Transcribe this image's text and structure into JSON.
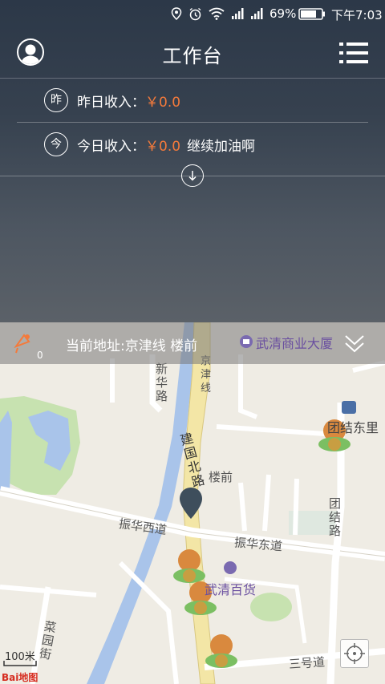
{
  "status_bar": {
    "battery": "69%",
    "time": "下午7:03"
  },
  "header": {
    "title": "工作台"
  },
  "income": {
    "yesterday": {
      "icon_char": "昨",
      "label": "昨日收入：",
      "amount": "￥0.0"
    },
    "today": {
      "icon_char": "今",
      "label": "今日收入：",
      "amount": "￥0.0",
      "slogan": "继续加油啊"
    }
  },
  "address_bar": {
    "label": "当前地址:京津线  楼前",
    "count": "0"
  },
  "map": {
    "labels": {
      "wuqing_building": "武清商业大厦",
      "xinhua_road": "新华路",
      "jingjin_line": "京津线",
      "jianguo_north_road": "建国北路",
      "louqian": "楼前",
      "tuanjie_east": "团结东里",
      "tuanjie_road": "团结路",
      "zhenhua_west": "振华西道",
      "zhenhua_east": "振华东道",
      "wuqing_department": "武清百货",
      "caiyuan_street": "菜园街",
      "sanhao_road": "三号道"
    },
    "scale": "100米",
    "logo": "Bai地图",
    "colors": {
      "water": "#a9c4ea",
      "green": "#c7e2b0",
      "road": "#ffffff",
      "main_road": "#f3e6a6"
    }
  },
  "colors": {
    "accent": "#f47a3b"
  }
}
